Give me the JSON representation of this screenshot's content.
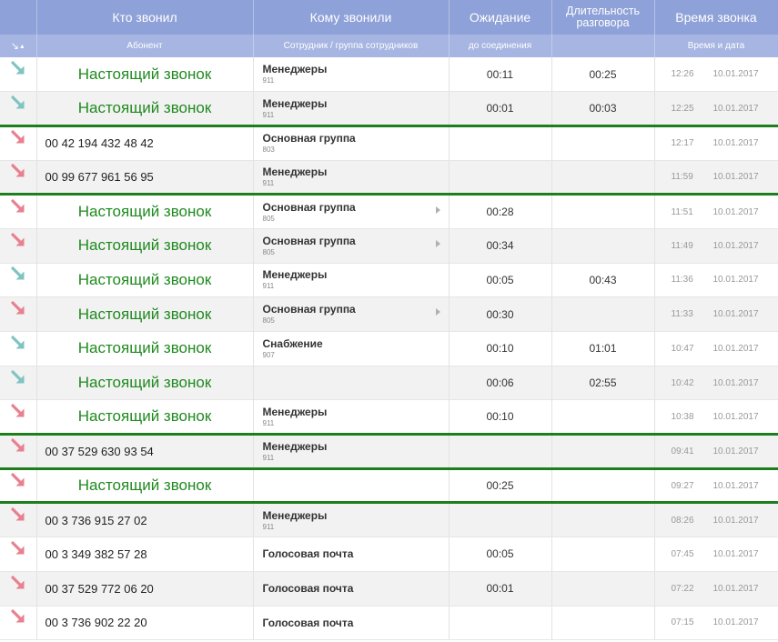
{
  "colors": {
    "header_top": "#8ea1d8",
    "header_sub": "#a6b5e2",
    "present_text": "#1f8a1f",
    "group_separator": "#1e7e1e",
    "arrow_answered": "#7fc4c2",
    "arrow_missed": "#e8808f"
  },
  "header": {
    "sort_icon": "sort-desc-arrow-icon",
    "columns": [
      {
        "title": "Кто звонил",
        "sub": "Абонент"
      },
      {
        "title": "Кому звонили",
        "sub": "Сотрудник / группа сотрудников"
      },
      {
        "title": "Ожидание",
        "sub": "до соединения"
      },
      {
        "title": "Длительность разговора",
        "sub": ""
      },
      {
        "title": "Время звонка",
        "sub": "Время и дата"
      }
    ]
  },
  "rows": [
    {
      "status": "answered",
      "caller": "Настоящий звонок",
      "present": true,
      "target": "Менеджеры",
      "target_num": "911",
      "wait": "00:11",
      "duration": "00:25",
      "time": "12:26",
      "date": "10.01.2017",
      "group_start": false,
      "expand": false
    },
    {
      "status": "answered",
      "caller": "Настоящий звонок",
      "present": true,
      "target": "Менеджеры",
      "target_num": "911",
      "wait": "00:01",
      "duration": "00:03",
      "time": "12:25",
      "date": "10.01.2017",
      "group_start": false,
      "expand": false
    },
    {
      "status": "missed",
      "caller": "00 42 194 432 48 42",
      "present": false,
      "target": "Основная группа",
      "target_num": "803",
      "wait": "",
      "duration": "",
      "time": "12:17",
      "date": "10.01.2017",
      "group_start": true,
      "expand": false
    },
    {
      "status": "missed",
      "caller": "00 99 677 961 56 95",
      "present": false,
      "target": "Менеджеры",
      "target_num": "911",
      "wait": "",
      "duration": "",
      "time": "11:59",
      "date": "10.01.2017",
      "group_start": false,
      "expand": false
    },
    {
      "status": "missed",
      "caller": "Настоящий звонок",
      "present": true,
      "target": "Основная группа",
      "target_num": "805",
      "wait": "00:28",
      "duration": "",
      "time": "11:51",
      "date": "10.01.2017",
      "group_start": true,
      "expand": true
    },
    {
      "status": "missed",
      "caller": "Настоящий звонок",
      "present": true,
      "target": "Основная группа",
      "target_num": "805",
      "wait": "00:34",
      "duration": "",
      "time": "11:49",
      "date": "10.01.2017",
      "group_start": false,
      "expand": true
    },
    {
      "status": "answered",
      "caller": "Настоящий звонок",
      "present": true,
      "target": "Менеджеры",
      "target_num": "911",
      "wait": "00:05",
      "duration": "00:43",
      "time": "11:36",
      "date": "10.01.2017",
      "group_start": false,
      "expand": false
    },
    {
      "status": "missed",
      "caller": "Настоящий звонок",
      "present": true,
      "target": "Основная группа",
      "target_num": "805",
      "wait": "00:30",
      "duration": "",
      "time": "11:33",
      "date": "10.01.2017",
      "group_start": false,
      "expand": true
    },
    {
      "status": "answered",
      "caller": "Настоящий звонок",
      "present": true,
      "target": "Снабжение",
      "target_num": "907",
      "wait": "00:10",
      "duration": "01:01",
      "time": "10:47",
      "date": "10.01.2017",
      "group_start": false,
      "expand": false
    },
    {
      "status": "answered",
      "caller": "Настоящий звонок",
      "present": true,
      "target": "",
      "target_num": "",
      "wait": "00:06",
      "duration": "02:55",
      "time": "10:42",
      "date": "10.01.2017",
      "group_start": false,
      "expand": false
    },
    {
      "status": "missed",
      "caller": "Настоящий звонок",
      "present": true,
      "target": "Менеджеры",
      "target_num": "911",
      "wait": "00:10",
      "duration": "",
      "time": "10:38",
      "date": "10.01.2017",
      "group_start": false,
      "expand": false
    },
    {
      "status": "missed",
      "caller": "00 37 529 630 93 54",
      "present": false,
      "target": "Менеджеры",
      "target_num": "911",
      "wait": "",
      "duration": "",
      "time": "09:41",
      "date": "10.01.2017",
      "group_start": true,
      "expand": false
    },
    {
      "status": "missed",
      "caller": "Настоящий звонок",
      "present": true,
      "target": "",
      "target_num": "",
      "wait": "00:25",
      "duration": "",
      "time": "09:27",
      "date": "10.01.2017",
      "group_start": true,
      "expand": false
    },
    {
      "status": "missed",
      "caller": "00 3 736 915 27 02",
      "present": false,
      "target": "Менеджеры",
      "target_num": "911",
      "wait": "",
      "duration": "",
      "time": "08:26",
      "date": "10.01.2017",
      "group_start": true,
      "expand": false
    },
    {
      "status": "missed",
      "caller": "00 3 349 382 57 28",
      "present": false,
      "target": "Голосовая почта",
      "target_num": "",
      "wait": "00:05",
      "duration": "",
      "time": "07:45",
      "date": "10.01.2017",
      "group_start": false,
      "expand": false
    },
    {
      "status": "missed",
      "caller": "00 37 529 772 06 20",
      "present": false,
      "target": "Голосовая почта",
      "target_num": "",
      "wait": "00:01",
      "duration": "",
      "time": "07:22",
      "date": "10.01.2017",
      "group_start": false,
      "expand": false
    },
    {
      "status": "missed",
      "caller": "00 3 736 902 22 20",
      "present": false,
      "target": "Голосовая почта",
      "target_num": "",
      "wait": "",
      "duration": "",
      "time": "07:15",
      "date": "10.01.2017",
      "group_start": false,
      "expand": false
    }
  ]
}
